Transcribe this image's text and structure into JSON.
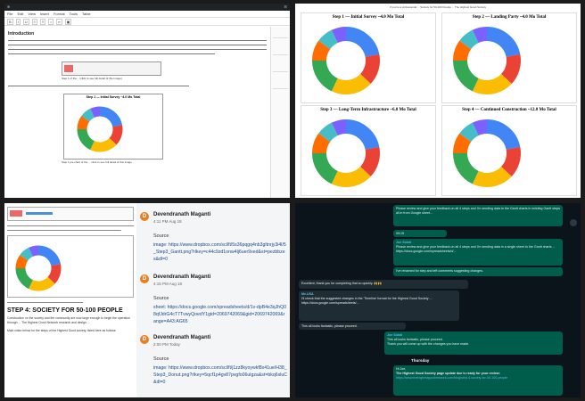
{
  "editor": {
    "menu": [
      "File",
      "Edit",
      "View",
      "Insert",
      "Format",
      "Tools",
      "Table"
    ],
    "heading": "Introduction",
    "fig1_caption": "Step 1 of the... (click to see full detail of this image)",
    "chart_title": "Step 1 — Initial Survey ~4.0 Mo Total",
    "fig2_caption": "Step 1 pie chart of the ... click to see full detail of this image"
  },
  "dashboard": {
    "note": "If you're a professional ... Society for 50-100 People ... The Highest Good Society",
    "charts": [
      {
        "title": "Step 1 — Initial Survey ~4.0 Mo Total"
      },
      {
        "title": "Step 2 — Landing Party ~4.0 Mo Total"
      },
      {
        "title": "Step 3 — Long-Term Infrastructure ~6.0 Mo Total"
      },
      {
        "title": "Step 4 — Continued Construction ~12.0 Mo Total"
      }
    ],
    "colors": [
      "#4285f4",
      "#ea4335",
      "#fbbc04",
      "#34a853",
      "#ff6d01",
      "#46bdc6",
      "#7b61ff",
      "#e8710a"
    ]
  },
  "doc": {
    "heading": "STEP 4: SOCIETY FOR 50-100 PEOPLE",
    "para1": "Construction on the society and the community are now large enough to begin the operation through ... The Highest Good Network research and design ...",
    "para2": "Main video below for the steps of the Highest Good society, listed here as follows:"
  },
  "comments": [
    {
      "avatar": "D",
      "name": "Devendranath Maganti",
      "time": "4:11 PM Aug 18",
      "label": "Source",
      "text": "image: https://www.dropbox.com/scl/fi/5s36pqgq4nb3gltnrjy3i4l/5_Step3_Gantt.png?rlkey=c44c9zd1onw4lj6uer9xed&st=pezbbzes&dl=0"
    },
    {
      "avatar": "D",
      "name": "Devendranath Maganti",
      "time": "4:15 PM Aug 18",
      "label": "Source",
      "text": "sheet: https://docs.google.com/spreadsheets/d/1v-dpB4e3qJhQ08qfJdrG4cT7TvwyQoedY1gid=2069742069&gid=2069742069&range=A43:AG65"
    },
    {
      "avatar": "D",
      "name": "Devendranath Maganti",
      "time": "2:00 PM Today",
      "label": "Source",
      "text": "image: https://www.dropbox.com/scl/fi/j1zz8kyoywkf8x41ue/H38_Step3_Donut.png?rlkey=5qcf1p4gv87pvgfo06ulgza&st=bkq6xluC&dl=0"
    }
  ],
  "chat": {
    "msg1": "Please review and give your feedback on all 4 steps and I'm sending data to the Gantt charts in existing Gantt steps all in from Google sheet...",
    "msg1_time": "09:15",
    "msg2_name": "Joe Sidoti",
    "msg2": "Please review and give your feedback on all 4 steps and I'm sending data in a single sheet to the Gantt charts ... https://docs.google.com/spreadsheets/d/...",
    "msg3": "I've renamed for step and left comments suggesting changes.",
    "msg4": "Excellent, thank you for completing that so quickly. 🙌🙌",
    "msg5_name": "Me.USA",
    "msg5": "I'll check that the suggested changes in the 'Timeline' format for the Highest Good Society ... https://docs.google.com/spreadsheets/...",
    "msg5b": "This all looks fantastic, please proceed.",
    "msg6_name": "Joe Sidoti",
    "msg6": "This all looks fantastic, please proceed.",
    "msg6b": "Thank you will come up with the changes you have made.",
    "day": "Thursday",
    "msg7_greet": "Hi Joe,",
    "msg7": "The Highest Good Society page update due is ready for your review:",
    "msg7_link": "https://www.thehighestgoodnetwork.com/blog/step-4-society-for-50-100-people"
  }
}
